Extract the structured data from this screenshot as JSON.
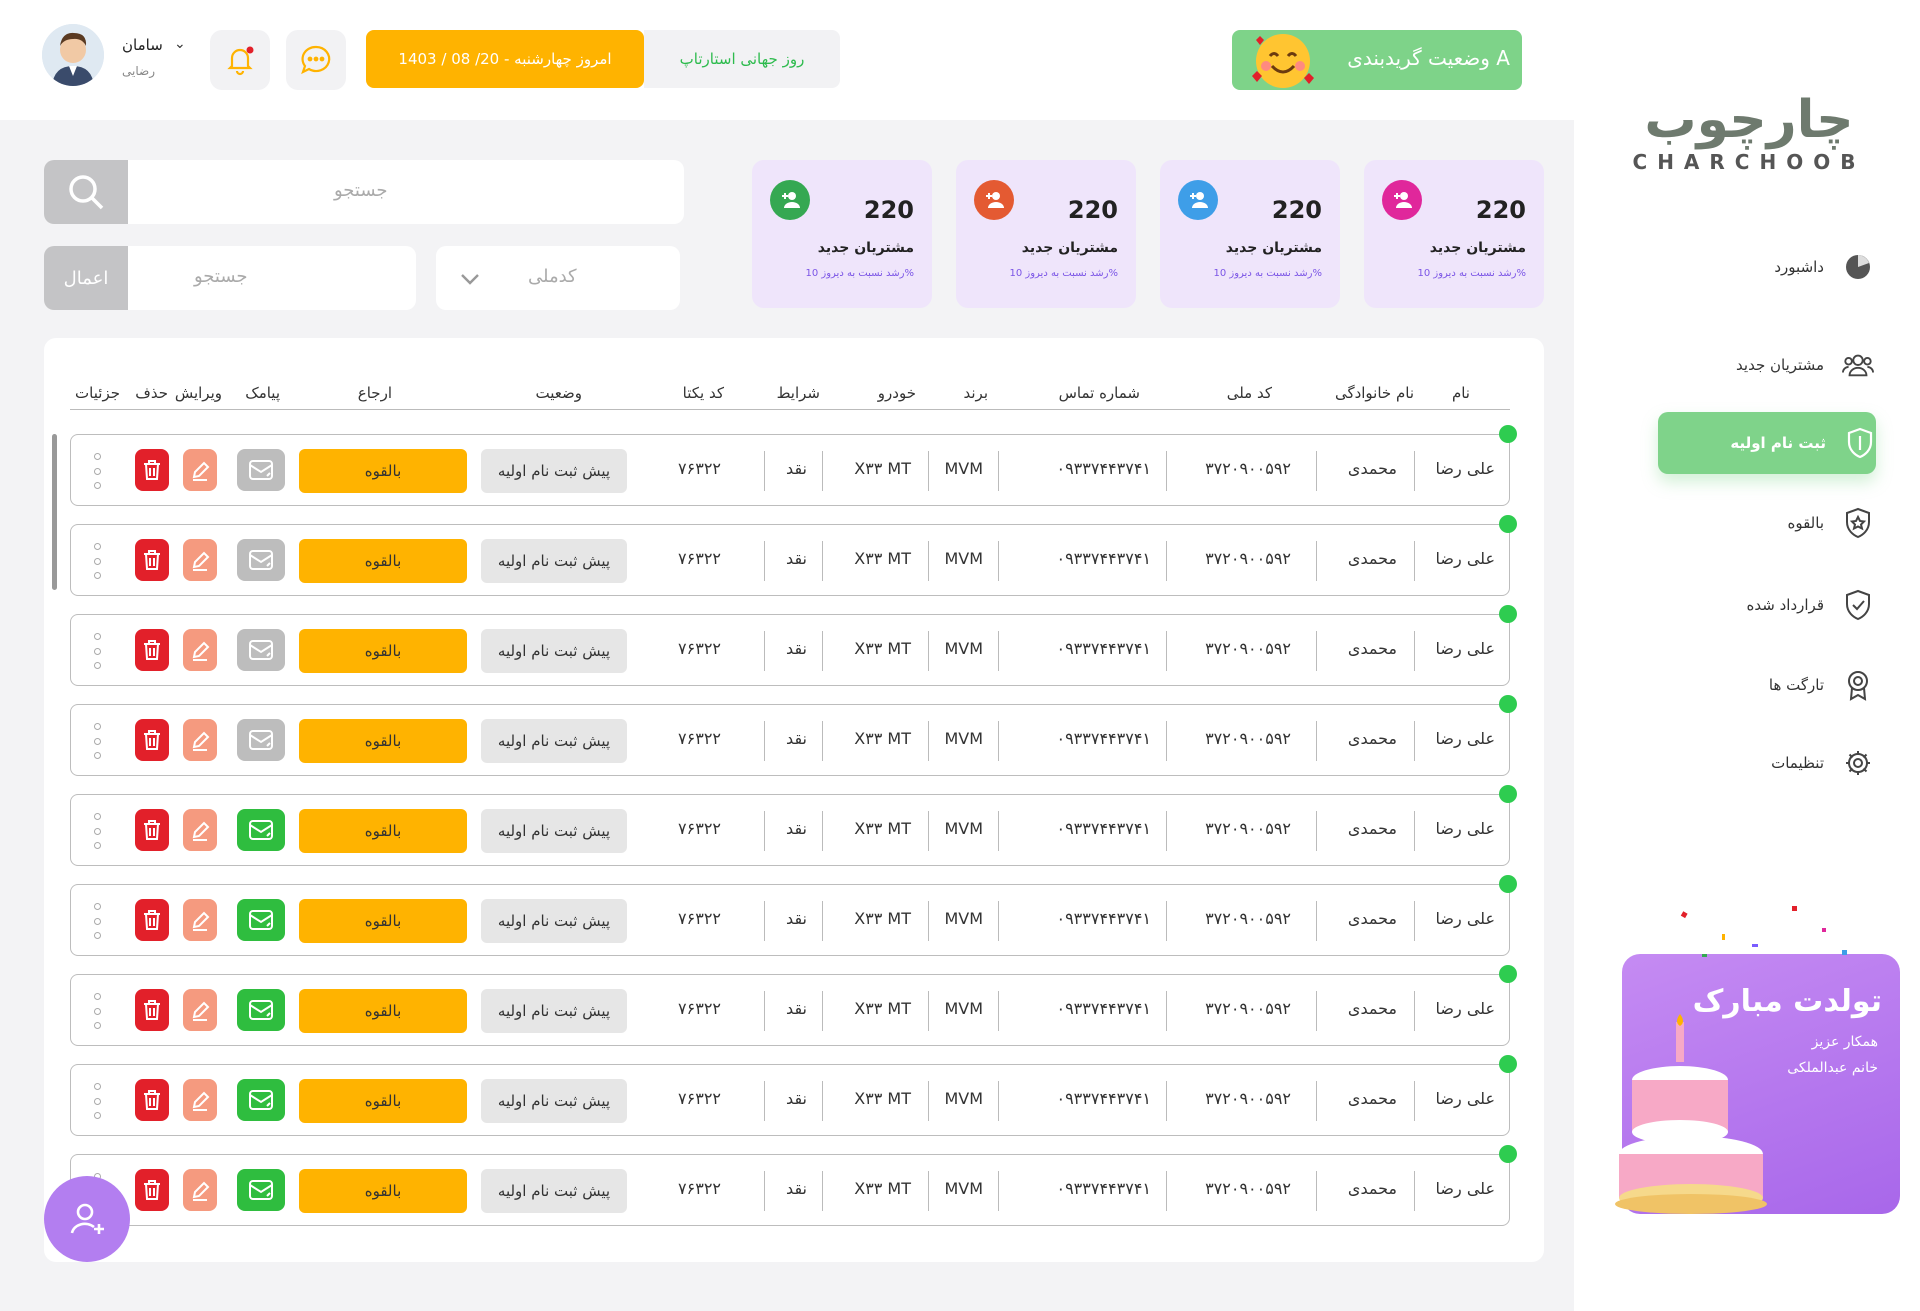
{
  "header": {
    "user": {
      "first_name": "سامان",
      "last_name": "رضایی"
    },
    "date_text": "امروز چهارشنبه - 20/ 08 / 1403",
    "event_text": "روز جهانی استارتاپ",
    "grade_text": "وضعیت گریدبندی A"
  },
  "cards": [
    {
      "value": "220",
      "label": "مشتریان جدید",
      "sub": "رشد نسبت به دیروز 10%",
      "color": "#e0279b"
    },
    {
      "value": "220",
      "label": "مشتریان جدید",
      "sub": "رشد نسبت به دیروز 10%",
      "color": "#3e9ee8"
    },
    {
      "value": "220",
      "label": "مشتریان جدید",
      "sub": "رشد نسبت به دیروز 10%",
      "color": "#e45a32"
    },
    {
      "value": "220",
      "label": "مشتریان جدید",
      "sub": "رشد نسبت به دیروز 10%",
      "color": "#35a852"
    }
  ],
  "search": {
    "placeholder": "جستجو"
  },
  "filter": {
    "placeholder": "جستجو",
    "apply_label": "اعمال",
    "select_value": "کدملی"
  },
  "table": {
    "headers": {
      "name": "نام",
      "family": "نام خانوادگی",
      "national_code": "کد ملی",
      "phone": "شماره تماس",
      "brand": "برند",
      "car": "خودرو",
      "terms": "شرایط",
      "unique_code": "کد یکتا",
      "status": "وضعیت",
      "referral": "ارجاع",
      "sms": "پیامک",
      "edit": "ویرایش",
      "delete": "حذف",
      "details": "جزئیات"
    },
    "rows": [
      {
        "name": "علی رضا",
        "family": "محمدی",
        "national_code": "۳۷۲۰۹۰۰۵۹۲",
        "phone": "۰۹۳۳۷۴۴۳۷۴۱",
        "brand": "MVM",
        "car": "X۳۳ MT",
        "terms": "نقد",
        "unique_code": "۷۶۳۲۲",
        "status": "پیش ثبت نام اولیه",
        "referral": "بالقوه",
        "sms_sent": false
      },
      {
        "name": "علی رضا",
        "family": "محمدی",
        "national_code": "۳۷۲۰۹۰۰۵۹۲",
        "phone": "۰۹۳۳۷۴۴۳۷۴۱",
        "brand": "MVM",
        "car": "X۳۳ MT",
        "terms": "نقد",
        "unique_code": "۷۶۳۲۲",
        "status": "پیش ثبت نام اولیه",
        "referral": "بالقوه",
        "sms_sent": false
      },
      {
        "name": "علی رضا",
        "family": "محمدی",
        "national_code": "۳۷۲۰۹۰۰۵۹۲",
        "phone": "۰۹۳۳۷۴۴۳۷۴۱",
        "brand": "MVM",
        "car": "X۳۳ MT",
        "terms": "نقد",
        "unique_code": "۷۶۳۲۲",
        "status": "پیش ثبت نام اولیه",
        "referral": "بالقوه",
        "sms_sent": false
      },
      {
        "name": "علی رضا",
        "family": "محمدی",
        "national_code": "۳۷۲۰۹۰۰۵۹۲",
        "phone": "۰۹۳۳۷۴۴۳۷۴۱",
        "brand": "MVM",
        "car": "X۳۳ MT",
        "terms": "نقد",
        "unique_code": "۷۶۳۲۲",
        "status": "پیش ثبت نام اولیه",
        "referral": "بالقوه",
        "sms_sent": false
      },
      {
        "name": "علی رضا",
        "family": "محمدی",
        "national_code": "۳۷۲۰۹۰۰۵۹۲",
        "phone": "۰۹۳۳۷۴۴۳۷۴۱",
        "brand": "MVM",
        "car": "X۳۳ MT",
        "terms": "نقد",
        "unique_code": "۷۶۳۲۲",
        "status": "پیش ثبت نام اولیه",
        "referral": "بالقوه",
        "sms_sent": true
      },
      {
        "name": "علی رضا",
        "family": "محمدی",
        "national_code": "۳۷۲۰۹۰۰۵۹۲",
        "phone": "۰۹۳۳۷۴۴۳۷۴۱",
        "brand": "MVM",
        "car": "X۳۳ MT",
        "terms": "نقد",
        "unique_code": "۷۶۳۲۲",
        "status": "پیش ثبت نام اولیه",
        "referral": "بالقوه",
        "sms_sent": true
      },
      {
        "name": "علی رضا",
        "family": "محمدی",
        "national_code": "۳۷۲۰۹۰۰۵۹۲",
        "phone": "۰۹۳۳۷۴۴۳۷۴۱",
        "brand": "MVM",
        "car": "X۳۳ MT",
        "terms": "نقد",
        "unique_code": "۷۶۳۲۲",
        "status": "پیش ثبت نام اولیه",
        "referral": "بالقوه",
        "sms_sent": true
      },
      {
        "name": "علی رضا",
        "family": "محمدی",
        "national_code": "۳۷۲۰۹۰۰۵۹۲",
        "phone": "۰۹۳۳۷۴۴۳۷۴۱",
        "brand": "MVM",
        "car": "X۳۳ MT",
        "terms": "نقد",
        "unique_code": "۷۶۳۲۲",
        "status": "پیش ثبت نام اولیه",
        "referral": "بالقوه",
        "sms_sent": true
      },
      {
        "name": "علی رضا",
        "family": "محمدی",
        "national_code": "۳۷۲۰۹۰۰۵۹۲",
        "phone": "۰۹۳۳۷۴۴۳۷۴۱",
        "brand": "MVM",
        "car": "X۳۳ MT",
        "terms": "نقد",
        "unique_code": "۷۶۳۲۲",
        "status": "پیش ثبت نام اولیه",
        "referral": "بالقوه",
        "sms_sent": true
      }
    ]
  },
  "sidebar": {
    "logo_fa": "چارچوب",
    "logo_en": "CHARCHOOB",
    "items": [
      {
        "label": "داشبورد",
        "icon": "pie-chart-icon",
        "active": false
      },
      {
        "label": "مشتریان جدید",
        "icon": "users-icon",
        "active": false
      },
      {
        "label": "ثبت نام اولیه",
        "icon": "shield-icon",
        "active": true
      },
      {
        "label": "بالقوه",
        "icon": "shield-star-icon",
        "active": false
      },
      {
        "label": "قرارداد شده",
        "icon": "shield-check-icon",
        "active": false
      },
      {
        "label": "تارگت ها",
        "icon": "badge-icon",
        "active": false
      },
      {
        "label": "تنظیمات",
        "icon": "gear-icon",
        "active": false
      }
    ],
    "birthday": {
      "title": "تولدت مبارک",
      "line1": "همکار عزیز",
      "line2": "خانم عبدالملکی"
    }
  },
  "colors": {
    "accent_green": "#7fd38a",
    "orange": "#ffb300",
    "purple": "#b37ef0",
    "delete_red": "#e2202a",
    "edit_salmon": "#f59a7f",
    "sms_green": "#2fbd3f",
    "sms_gray": "#bdbdbd"
  }
}
